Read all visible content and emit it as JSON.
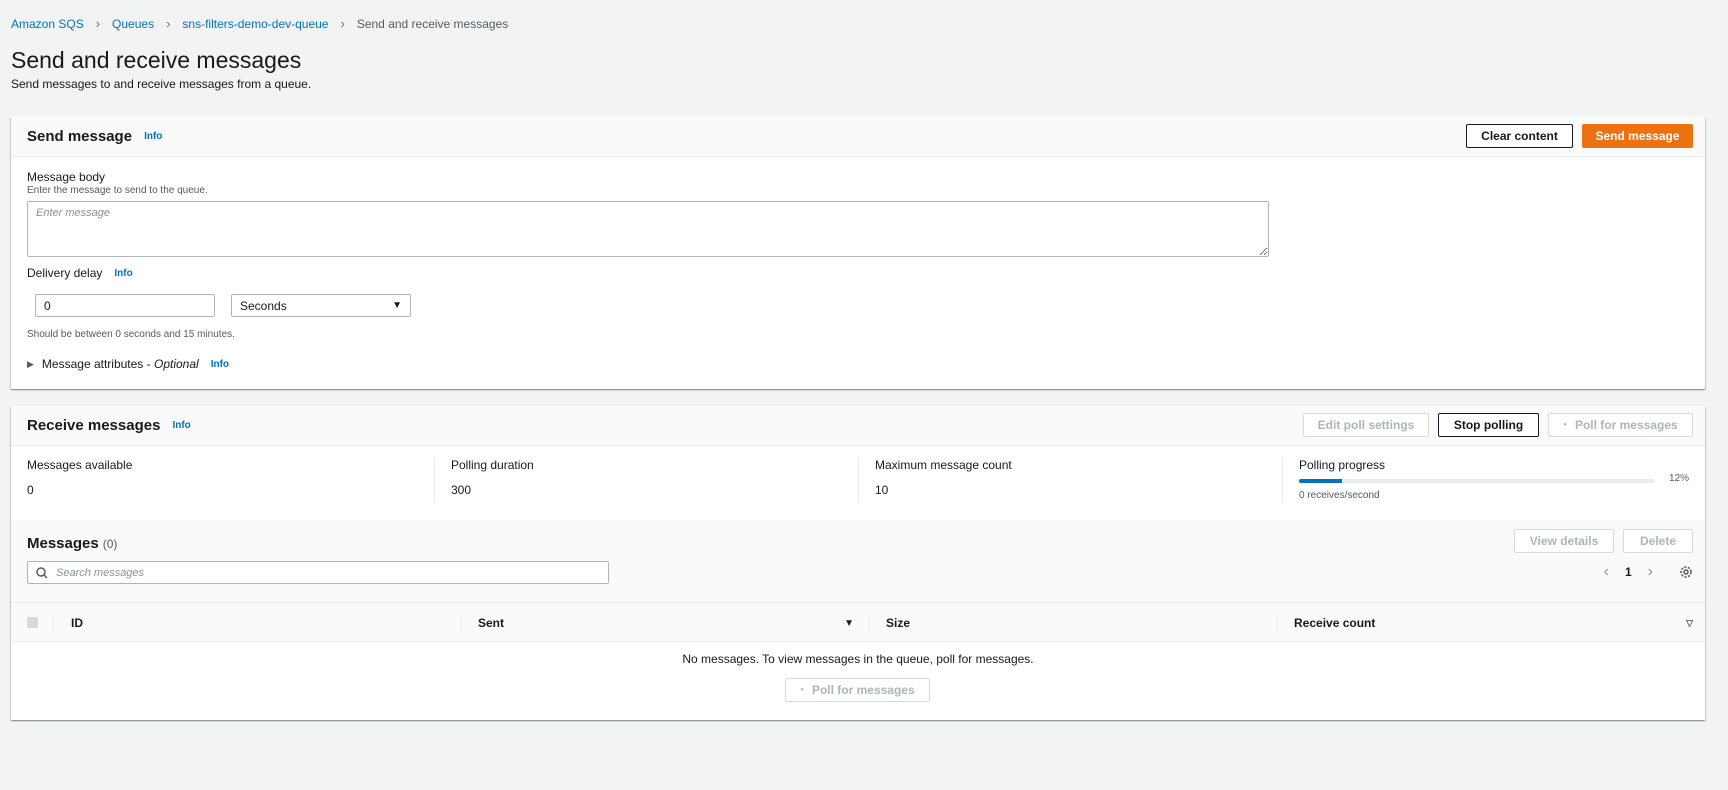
{
  "breadcrumb": {
    "items": [
      "Amazon SQS",
      "Queues",
      "sns-filters-demo-dev-queue"
    ],
    "current": "Send and receive messages"
  },
  "page": {
    "title": "Send and receive messages",
    "subtitle": "Send messages to and receive messages from a queue."
  },
  "send": {
    "title": "Send message",
    "info": "Info",
    "clear_label": "Clear content",
    "send_label": "Send message",
    "body_label": "Message body",
    "body_desc": "Enter the message to send to the queue.",
    "body_placeholder": "Enter message",
    "delay_label": "Delivery delay",
    "delay_info": "Info",
    "delay_value": "0",
    "delay_unit": "Seconds",
    "delay_hint": "Should be between 0 seconds and 15 minutes.",
    "attributes_label": "Message attributes - ",
    "attributes_optional": "Optional",
    "attributes_info": "Info"
  },
  "receive": {
    "title": "Receive messages",
    "info": "Info",
    "edit_label": "Edit poll settings",
    "stop_label": "Stop polling",
    "poll_label": "Poll for messages",
    "stats": {
      "available_label": "Messages available",
      "available_value": "0",
      "duration_label": "Polling duration",
      "duration_value": "300",
      "max_label": "Maximum message count",
      "max_value": "10",
      "progress_label": "Polling progress",
      "progress_percent": "12%",
      "progress_fraction": 0.12,
      "rate": "0 receives/second"
    }
  },
  "messages": {
    "title": "Messages",
    "count": "(0)",
    "view_label": "View details",
    "delete_label": "Delete",
    "search_placeholder": "Search messages",
    "page": "1",
    "columns": [
      "ID",
      "Sent",
      "Size",
      "Receive count"
    ],
    "empty_text": "No messages. To view messages in the queue, poll for messages.",
    "poll_label": "Poll for messages"
  },
  "colors": {
    "accent": "#ec7211",
    "link": "#0073bb",
    "progress": "#0073bb"
  }
}
